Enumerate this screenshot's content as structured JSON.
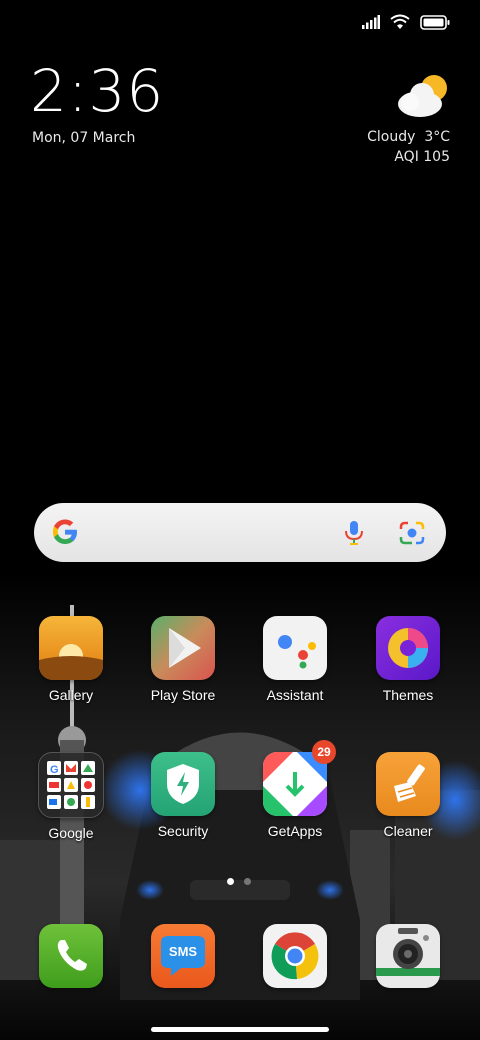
{
  "status_bar": {
    "icons": [
      "signal-icon",
      "wifi-icon",
      "battery-icon"
    ]
  },
  "clock_widget": {
    "time": "2:36",
    "date": "Mon, 07 March"
  },
  "weather_widget": {
    "icon": "partly-cloudy-icon",
    "condition": "Cloudy",
    "temperature": "3°C",
    "aqi": "AQI 105"
  },
  "search_bar": {
    "icons": [
      "google-logo",
      "mic-icon",
      "lens-icon"
    ]
  },
  "apps_row1": [
    {
      "label": "Gallery"
    },
    {
      "label": "Play Store"
    },
    {
      "label": "Assistant"
    },
    {
      "label": "Themes"
    }
  ],
  "apps_row2": [
    {
      "label": "Google"
    },
    {
      "label": "Security"
    },
    {
      "label": "GetApps",
      "badge": "29"
    },
    {
      "label": "Cleaner"
    }
  ],
  "dock": [
    {
      "icon": "phone-icon"
    },
    {
      "icon": "sms-icon",
      "text": "SMS"
    },
    {
      "icon": "chrome-icon"
    },
    {
      "icon": "camera-icon"
    }
  ],
  "page_indicator": {
    "pages": 2,
    "active": 1
  },
  "colors": {
    "background": "#000000",
    "search_bar": "#eeeeee",
    "badge": "#e8472c"
  }
}
